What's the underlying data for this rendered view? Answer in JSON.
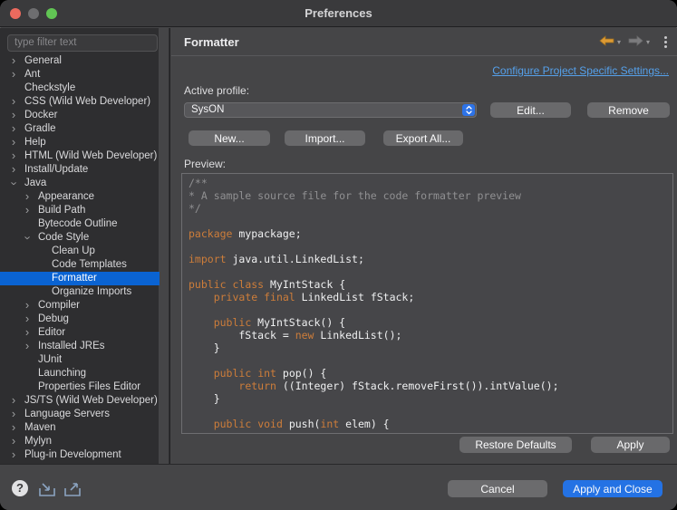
{
  "window": {
    "title": "Preferences"
  },
  "titlebar": {
    "buttons": [
      "close",
      "minimize-disabled",
      "zoom"
    ]
  },
  "sidebar": {
    "filter_placeholder": "type filter text",
    "items": [
      {
        "label": "General",
        "level": 0,
        "chevron": "collapsed",
        "selected": false
      },
      {
        "label": "Ant",
        "level": 0,
        "chevron": "collapsed",
        "selected": false
      },
      {
        "label": "Checkstyle",
        "level": 0,
        "chevron": "none",
        "selected": false
      },
      {
        "label": "CSS (Wild Web Developer)",
        "level": 0,
        "chevron": "collapsed",
        "selected": false
      },
      {
        "label": "Docker",
        "level": 0,
        "chevron": "collapsed",
        "selected": false
      },
      {
        "label": "Gradle",
        "level": 0,
        "chevron": "collapsed",
        "selected": false
      },
      {
        "label": "Help",
        "level": 0,
        "chevron": "collapsed",
        "selected": false
      },
      {
        "label": "HTML (Wild Web Developer)",
        "level": 0,
        "chevron": "collapsed",
        "selected": false
      },
      {
        "label": "Install/Update",
        "level": 0,
        "chevron": "collapsed",
        "selected": false
      },
      {
        "label": "Java",
        "level": 0,
        "chevron": "expanded",
        "selected": false
      },
      {
        "label": "Appearance",
        "level": 1,
        "chevron": "collapsed",
        "selected": false
      },
      {
        "label": "Build Path",
        "level": 1,
        "chevron": "collapsed",
        "selected": false
      },
      {
        "label": "Bytecode Outline",
        "level": 1,
        "chevron": "none",
        "selected": false
      },
      {
        "label": "Code Style",
        "level": 1,
        "chevron": "expanded",
        "selected": false
      },
      {
        "label": "Clean Up",
        "level": 2,
        "chevron": "none",
        "selected": false
      },
      {
        "label": "Code Templates",
        "level": 2,
        "chevron": "none",
        "selected": false
      },
      {
        "label": "Formatter",
        "level": 2,
        "chevron": "none",
        "selected": true
      },
      {
        "label": "Organize Imports",
        "level": 2,
        "chevron": "none",
        "selected": false
      },
      {
        "label": "Compiler",
        "level": 1,
        "chevron": "collapsed",
        "selected": false
      },
      {
        "label": "Debug",
        "level": 1,
        "chevron": "collapsed",
        "selected": false
      },
      {
        "label": "Editor",
        "level": 1,
        "chevron": "collapsed",
        "selected": false
      },
      {
        "label": "Installed JREs",
        "level": 1,
        "chevron": "collapsed",
        "selected": false
      },
      {
        "label": "JUnit",
        "level": 1,
        "chevron": "none",
        "selected": false
      },
      {
        "label": "Launching",
        "level": 1,
        "chevron": "none",
        "selected": false
      },
      {
        "label": "Properties Files Editor",
        "level": 1,
        "chevron": "none",
        "selected": false
      },
      {
        "label": "JS/TS (Wild Web Developer)",
        "level": 0,
        "chevron": "collapsed",
        "selected": false
      },
      {
        "label": "Language Servers",
        "level": 0,
        "chevron": "collapsed",
        "selected": false
      },
      {
        "label": "Maven",
        "level": 0,
        "chevron": "collapsed",
        "selected": false
      },
      {
        "label": "Mylyn",
        "level": 0,
        "chevron": "collapsed",
        "selected": false
      },
      {
        "label": "Plug-in Development",
        "level": 0,
        "chevron": "collapsed",
        "selected": false
      }
    ]
  },
  "header": {
    "title": "Formatter",
    "icons": [
      "back-arrow",
      "back-history-dropdown",
      "forward-arrow-disabled",
      "forward-history-dropdown",
      "view-menu"
    ]
  },
  "main": {
    "link_label": "Configure Project Specific Settings...",
    "active_profile_label": "Active profile:",
    "profile_value": "SysON",
    "buttons": {
      "edit": "Edit...",
      "remove": "Remove",
      "new": "New...",
      "import": "Import...",
      "export_all": "Export All...",
      "restore_defaults": "Restore Defaults",
      "apply": "Apply"
    },
    "preview_label": "Preview:",
    "preview_code": [
      [
        [
          "c",
          "/**"
        ]
      ],
      [
        [
          "c",
          "* A sample source file for the code formatter preview"
        ]
      ],
      [
        [
          "c",
          "*/"
        ]
      ],
      [],
      [
        [
          "k",
          "package"
        ],
        [
          "p",
          " mypackage;"
        ]
      ],
      [],
      [
        [
          "k",
          "import"
        ],
        [
          "p",
          " java.util.LinkedList;"
        ]
      ],
      [],
      [
        [
          "k",
          "public"
        ],
        [
          "p",
          " "
        ],
        [
          "k",
          "class"
        ],
        [
          "p",
          " MyIntStack {"
        ]
      ],
      [
        [
          "p",
          "    "
        ],
        [
          "k",
          "private"
        ],
        [
          "p",
          " "
        ],
        [
          "k",
          "final"
        ],
        [
          "p",
          " LinkedList fStack;"
        ]
      ],
      [],
      [
        [
          "p",
          "    "
        ],
        [
          "k",
          "public"
        ],
        [
          "p",
          " MyIntStack() {"
        ]
      ],
      [
        [
          "p",
          "        fStack = "
        ],
        [
          "k",
          "new"
        ],
        [
          "p",
          " LinkedList();"
        ]
      ],
      [
        [
          "p",
          "    }"
        ]
      ],
      [],
      [
        [
          "p",
          "    "
        ],
        [
          "k",
          "public"
        ],
        [
          "p",
          " "
        ],
        [
          "k",
          "int"
        ],
        [
          "p",
          " pop() {"
        ]
      ],
      [
        [
          "p",
          "        "
        ],
        [
          "k",
          "return"
        ],
        [
          "p",
          " ((Integer) fStack.removeFirst()).intValue();"
        ]
      ],
      [
        [
          "p",
          "    }"
        ]
      ],
      [],
      [
        [
          "p",
          "    "
        ],
        [
          "k",
          "public"
        ],
        [
          "p",
          " "
        ],
        [
          "k",
          "void"
        ],
        [
          "p",
          " push("
        ],
        [
          "k",
          "int"
        ],
        [
          "p",
          " elem) {"
        ]
      ]
    ]
  },
  "footer": {
    "cancel_label": "Cancel",
    "apply_close_label": "Apply and Close",
    "icons": [
      "help",
      "import-preferences",
      "export-preferences"
    ]
  },
  "colors": {
    "selection_blue": "#0a63d2",
    "accent_blue": "#2472e4",
    "link_blue": "#55a0ea",
    "keyword_orange": "#cd7d3a",
    "back_arrow_orange": "#dd9a33",
    "panel_bg": "#454547",
    "sidebar_bg": "#2e2e30"
  }
}
